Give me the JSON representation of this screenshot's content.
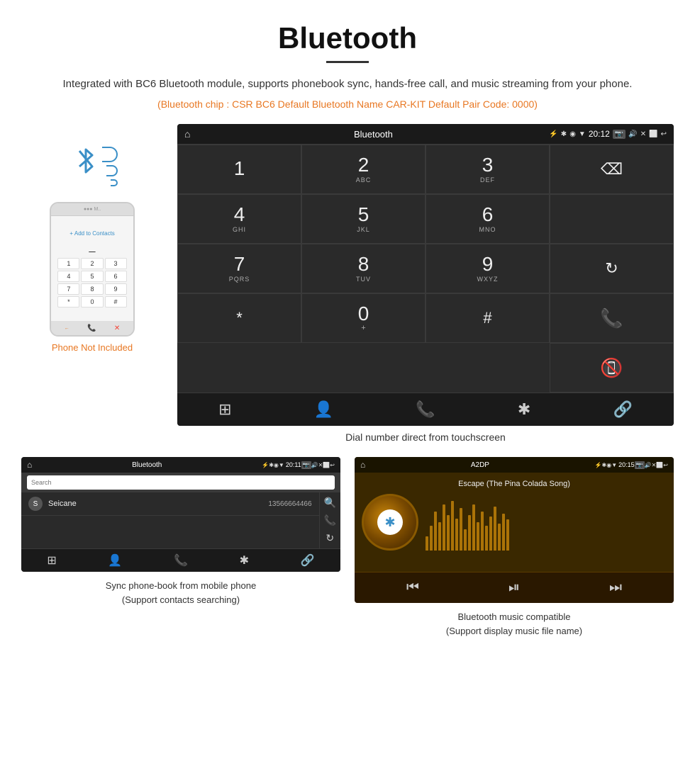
{
  "page": {
    "title": "Bluetooth",
    "description": "Integrated with BC6 Bluetooth module, supports phonebook sync, hands-free call, and music streaming from your phone.",
    "specs": "(Bluetooth chip : CSR BC6    Default Bluetooth Name CAR-KIT    Default Pair Code: 0000)",
    "dial_caption": "Dial number direct from touchscreen",
    "phonebook_caption": "Sync phone-book from mobile phone\n(Support contacts searching)",
    "music_caption": "Bluetooth music compatible\n(Support display music file name)"
  },
  "phone": {
    "not_included_label": "Phone Not Included"
  },
  "main_screen": {
    "status": {
      "title": "Bluetooth",
      "time": "20:12"
    },
    "dialpad": {
      "keys": [
        {
          "num": "1",
          "letters": ""
        },
        {
          "num": "2",
          "letters": "ABC"
        },
        {
          "num": "3",
          "letters": "DEF"
        },
        {
          "num": "backspace",
          "letters": ""
        },
        {
          "num": "4",
          "letters": "GHI"
        },
        {
          "num": "5",
          "letters": "JKL"
        },
        {
          "num": "6",
          "letters": "MNO"
        },
        {
          "num": "empty1",
          "letters": ""
        },
        {
          "num": "7",
          "letters": "PQRS"
        },
        {
          "num": "8",
          "letters": "TUV"
        },
        {
          "num": "9",
          "letters": "WXYZ"
        },
        {
          "num": "refresh",
          "letters": ""
        },
        {
          "num": "*",
          "letters": ""
        },
        {
          "num": "0+",
          "letters": ""
        },
        {
          "num": "#",
          "letters": ""
        },
        {
          "num": "call",
          "letters": ""
        },
        {
          "num": "endcall",
          "letters": ""
        }
      ]
    },
    "bottom_nav": [
      "grid",
      "person",
      "phone",
      "bluetooth",
      "link"
    ]
  },
  "phonebook_screen": {
    "status": {
      "title": "Bluetooth",
      "time": "20:11"
    },
    "search_placeholder": "Search",
    "contacts": [
      {
        "letter": "S",
        "name": "Seicane",
        "phone": "13566664466"
      }
    ],
    "bottom_nav": [
      "grid",
      "person",
      "phone",
      "bluetooth",
      "link"
    ]
  },
  "music_screen": {
    "status": {
      "title": "A2DP",
      "time": "20:15"
    },
    "song_title": "Escape (The Pina Colada Song)",
    "eq_bars": [
      20,
      35,
      55,
      40,
      65,
      50,
      70,
      45,
      60,
      30,
      50,
      65,
      40,
      55,
      35,
      48,
      62,
      38,
      52,
      44
    ],
    "controls": [
      "prev",
      "play-pause",
      "next"
    ]
  }
}
